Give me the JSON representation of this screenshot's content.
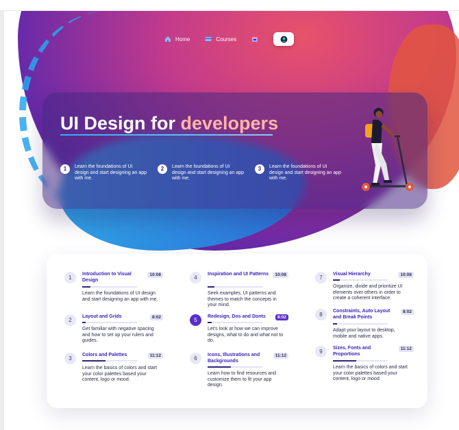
{
  "nav": {
    "items": [
      {
        "label": "Home",
        "icon": "home-icon"
      },
      {
        "label": "Courses",
        "icon": "courses-icon"
      },
      {
        "label": "",
        "icon": "calendar-icon"
      },
      {
        "label": "",
        "icon": "profile-icon"
      }
    ]
  },
  "hero": {
    "title_part1": "UI Design for ",
    "title_part2": "developers",
    "points": [
      {
        "num": "1",
        "text": "Learn the foundations of UI design and start designing an app with me."
      },
      {
        "num": "2",
        "text": "Learn the foundations of UI design and start designing an app with me."
      },
      {
        "num": "3",
        "text": "Learn the foundations of UI design and start designing an app with me."
      }
    ]
  },
  "lessons": [
    {
      "num": "1",
      "title": "Introduction to Visual Design",
      "time": "10:08",
      "progress": 0.15,
      "desc": "Learn the foundations of UI design and start designing an app with me.",
      "active": false
    },
    {
      "num": "2",
      "title": "Layout and Grids",
      "time": "8:02",
      "progress": 0.06,
      "desc": "Get familiar with negative spacing and how to set up your rulers and guides.",
      "active": false
    },
    {
      "num": "3",
      "title": "Colors and Palettes",
      "time": "11:12",
      "progress": 0.42,
      "desc": "Learn the basics of colors and start your color palettes based your content, logo or mood.",
      "active": false
    },
    {
      "num": "4",
      "title": "Inspiration and UI Patterns",
      "time": "10:08",
      "progress": 0.12,
      "desc": "Seek examples, UI patterns and themes to match the concepts in your mind.",
      "active": false
    },
    {
      "num": "5",
      "title": "Redesign, Dos and Donts",
      "time": "8:02",
      "progress": 0.08,
      "desc": "Let's look at how we can improve designs, what to do and what not to do.",
      "active": true
    },
    {
      "num": "6",
      "title": "Icons, Illustrations and Backgrounds",
      "time": "11:12",
      "progress": 0.42,
      "desc": "Learn how to find resources and customize them to fit your app design.",
      "active": false
    },
    {
      "num": "7",
      "title": "Visual Hierarchy",
      "time": "10:08",
      "progress": 0.12,
      "desc": "Organize, divide and prioritize UI elements over others in order to create a coherent interface.",
      "active": false
    },
    {
      "num": "8",
      "title": "Constraints, Auto Layout and Break Points",
      "time": "8:02",
      "progress": 0.08,
      "desc": "Adapt your layout to desktop, mobile and native apps.",
      "active": false
    },
    {
      "num": "9",
      "title": "Sizes, Fonts and Proportions",
      "time": "11:12",
      "progress": 0.42,
      "desc": "Learn the basics of colors and start your color palettes based your content, logo or mood.",
      "active": false
    }
  ],
  "colors": {
    "accent": "#5a2fc9",
    "title": "#3a22b8",
    "highlight": "#ffb6a6"
  }
}
